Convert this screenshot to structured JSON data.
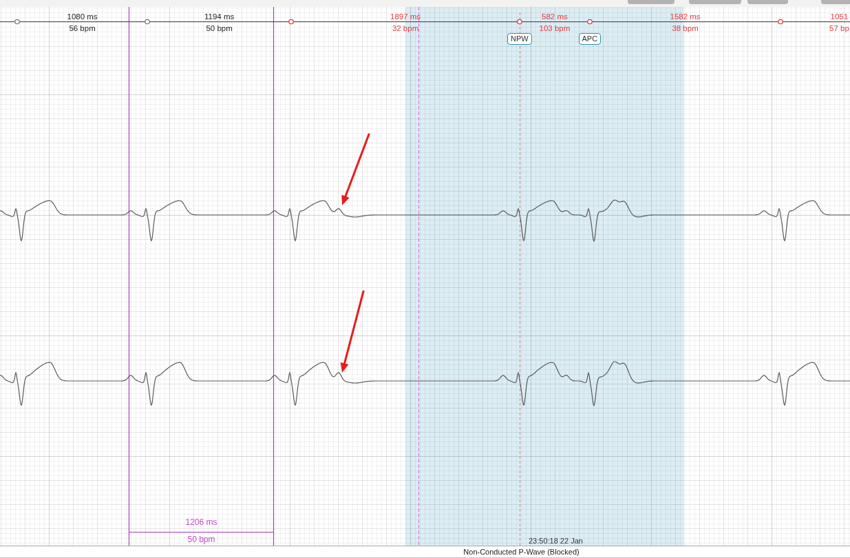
{
  "toolbar": [
    {
      "kind": "button"
    },
    {
      "kind": "button"
    },
    {
      "kind": "button"
    },
    {
      "kind": "button"
    }
  ],
  "rr_intervals": [
    {
      "ms": "1080 ms",
      "bpm": "56 bpm",
      "flagged": false
    },
    {
      "ms": "1194 ms",
      "bpm": "50 bpm",
      "flagged": false
    },
    {
      "ms": "1897 ms",
      "bpm": "32 bpm",
      "flagged": true
    },
    {
      "ms": "582 ms",
      "bpm": "103 bpm",
      "flagged": true
    },
    {
      "ms": "1582 ms",
      "bpm": "38 bpm",
      "flagged": true
    },
    {
      "ms": "1051",
      "bpm": "57 bp",
      "flagged": true
    }
  ],
  "beats": [
    {
      "flagged": false
    },
    {
      "flagged": false
    },
    {
      "flagged": true
    },
    {
      "flagged": true,
      "label": "NPW"
    },
    {
      "flagged": true,
      "label": "APC"
    },
    {
      "flagged": true
    }
  ],
  "traces": [
    {
      "arrow": true
    },
    {
      "arrow": true
    }
  ],
  "caliper": {
    "duration": "1206 ms",
    "rate": "50 bpm"
  },
  "cursor": {
    "timestamp": "23:50:18 22 Jan"
  },
  "event": {
    "title": "Non-Conducted P-Wave (Blocked)",
    "highlighted": true
  }
}
